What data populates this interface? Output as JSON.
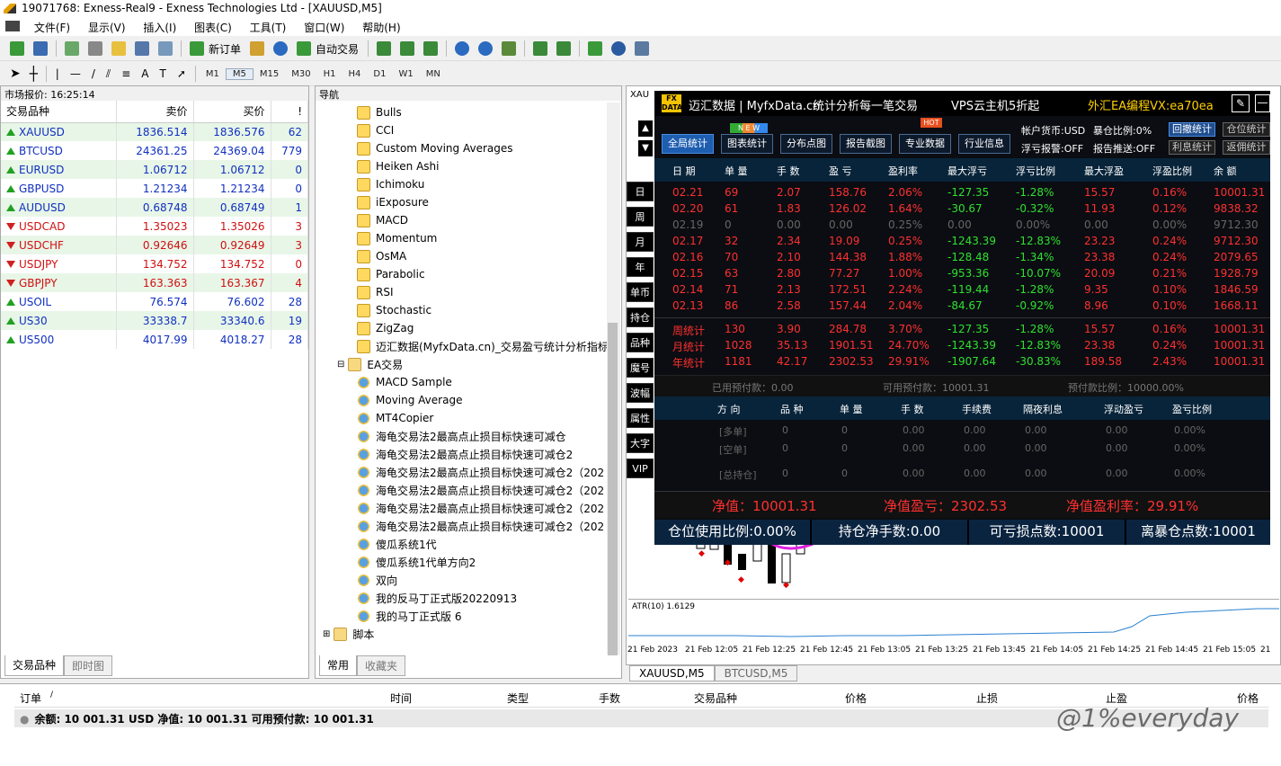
{
  "window": {
    "title": "19071768: Exness-Real9 - Exness Technologies Ltd - [XAUUSD,M5]"
  },
  "menu": [
    "文件(F)",
    "显示(V)",
    "插入(I)",
    "图表(C)",
    "工具(T)",
    "窗口(W)",
    "帮助(H)"
  ],
  "toolbar": {
    "new_order": "新订单",
    "auto_trade": "自动交易",
    "timeframes": [
      "M1",
      "M5",
      "M15",
      "M30",
      "H1",
      "H4",
      "D1",
      "W1",
      "MN"
    ],
    "active_tf": "M5"
  },
  "market_watch": {
    "title": "市场报价: 16:25:14",
    "cols": [
      "交易品种",
      "卖价",
      "买价",
      "!"
    ],
    "rows": [
      {
        "sym": "XAUUSD",
        "bid": "1836.514",
        "ask": "1836.576",
        "spread": "62",
        "dir": "up"
      },
      {
        "sym": "BTCUSD",
        "bid": "24361.25",
        "ask": "24369.04",
        "spread": "779",
        "dir": "up"
      },
      {
        "sym": "EURUSD",
        "bid": "1.06712",
        "ask": "1.06712",
        "spread": "0",
        "dir": "up"
      },
      {
        "sym": "GBPUSD",
        "bid": "1.21234",
        "ask": "1.21234",
        "spread": "0",
        "dir": "up"
      },
      {
        "sym": "AUDUSD",
        "bid": "0.68748",
        "ask": "0.68749",
        "spread": "1",
        "dir": "up"
      },
      {
        "sym": "USDCAD",
        "bid": "1.35023",
        "ask": "1.35026",
        "spread": "3",
        "dir": "dn"
      },
      {
        "sym": "USDCHF",
        "bid": "0.92646",
        "ask": "0.92649",
        "spread": "3",
        "dir": "dn"
      },
      {
        "sym": "USDJPY",
        "bid": "134.752",
        "ask": "134.752",
        "spread": "0",
        "dir": "dn"
      },
      {
        "sym": "GBPJPY",
        "bid": "163.363",
        "ask": "163.367",
        "spread": "4",
        "dir": "dn"
      },
      {
        "sym": "USOIL",
        "bid": "76.574",
        "ask": "76.602",
        "spread": "28",
        "dir": "up"
      },
      {
        "sym": "US30",
        "bid": "33338.7",
        "ask": "33340.6",
        "spread": "19",
        "dir": "up"
      },
      {
        "sym": "US500",
        "bid": "4017.99",
        "ask": "4018.27",
        "spread": "28",
        "dir": "up"
      }
    ],
    "tabs": [
      "交易品种",
      "即时图"
    ]
  },
  "navigator": {
    "title": "导航",
    "indicators": [
      "Bulls",
      "CCI",
      "Custom Moving Averages",
      "Heiken Ashi",
      "Ichimoku",
      "iExposure",
      "MACD",
      "Momentum",
      "OsMA",
      "Parabolic",
      "RSI",
      "Stochastic",
      "ZigZag",
      "迈汇数据(MyfxData.cn)_交易盈亏统计分析指标"
    ],
    "ea_folder": "EA交易",
    "eas": [
      "MACD Sample",
      "Moving Average",
      "MT4Copier",
      "海龟交易法2最高点止损目标快速可减仓",
      "海龟交易法2最高点止损目标快速可减仓2",
      "海龟交易法2最高点止损目标快速可减仓2（202",
      "海龟交易法2最高点止损目标快速可减仓2（202",
      "海龟交易法2最高点止损目标快速可减仓2（202",
      "海龟交易法2最高点止损目标快速可减仓2（202",
      "傻瓜系统1代",
      "傻瓜系统1代单方向2",
      "双向",
      "我的反马丁正式版20220913",
      "我的马丁正式版 6"
    ],
    "scripts": "脚本",
    "tabs": [
      "常用",
      "收藏夹"
    ]
  },
  "ea_panel": {
    "logo": "FX DATA",
    "brand": "迈汇数据 | MyfxData.cn",
    "slogan": "统计分析每一笔交易",
    "vps": "VPS云主机5折起",
    "promo": "外汇EA编程VX:ea70ea",
    "buttons": [
      "全局统计",
      "图表统计",
      "分布点图",
      "报告截图",
      "专业数据",
      "行业信息"
    ],
    "new_badge": "N E W",
    "hot_badge": "HOT",
    "status": [
      "帐户货币:USD",
      "暴仓比例:0%",
      "浮亏报警:OFF",
      "报告推送:OFF"
    ],
    "right_buttons": [
      "回撤统计",
      "仓位统计",
      "利息统计",
      "返佣统计"
    ],
    "side": [
      "日",
      "周",
      "月",
      "年",
      "单币",
      "持仓",
      "品种",
      "魔号",
      "波幅",
      "属性",
      "大字",
      "VIP"
    ],
    "cols": [
      "日 期",
      "单 量",
      "手 数",
      "盈 亏",
      "盈利率",
      "最大浮亏",
      "浮亏比例",
      "最大浮盈",
      "浮盈比例",
      "余 额"
    ],
    "rows": [
      [
        "02.21",
        "69",
        "2.07",
        "158.76",
        "2.06%",
        "-127.35",
        "-1.28%",
        "15.57",
        "0.16%",
        "10001.31"
      ],
      [
        "02.20",
        "61",
        "1.83",
        "126.02",
        "1.64%",
        "-30.67",
        "-0.32%",
        "11.93",
        "0.12%",
        "9838.32"
      ],
      [
        "02.19",
        "0",
        "0.00",
        "0.00",
        "0.25%",
        "0.00",
        "0.00%",
        "0.00",
        "0.00%",
        "9712.30"
      ],
      [
        "02.17",
        "32",
        "2.34",
        "19.09",
        "0.25%",
        "-1243.39",
        "-12.83%",
        "23.23",
        "0.24%",
        "9712.30"
      ],
      [
        "02.16",
        "70",
        "2.10",
        "144.38",
        "1.88%",
        "-128.48",
        "-1.34%",
        "23.38",
        "0.24%",
        "2079.65"
      ],
      [
        "02.15",
        "63",
        "2.80",
        "77.27",
        "1.00%",
        "-953.36",
        "-10.07%",
        "20.09",
        "0.21%",
        "1928.79"
      ],
      [
        "02.14",
        "71",
        "2.13",
        "172.51",
        "2.24%",
        "-119.44",
        "-1.28%",
        "9.35",
        "0.10%",
        "1846.59"
      ],
      [
        "02.13",
        "86",
        "2.58",
        "157.44",
        "2.04%",
        "-84.67",
        "-0.92%",
        "8.96",
        "0.10%",
        "1668.11"
      ]
    ],
    "summary": [
      [
        "周统计",
        "130",
        "3.90",
        "284.78",
        "3.70%",
        "-127.35",
        "-1.28%",
        "15.57",
        "0.16%",
        "10001.31"
      ],
      [
        "月统计",
        "1028",
        "35.13",
        "1901.51",
        "24.70%",
        "-1243.39",
        "-12.83%",
        "23.38",
        "0.24%",
        "10001.31"
      ],
      [
        "年统计",
        "1181",
        "42.17",
        "2302.53",
        "29.91%",
        "-1907.64",
        "-30.83%",
        "189.58",
        "2.43%",
        "10001.31"
      ]
    ],
    "margin_line": [
      "已用预付款：0.00",
      "可用预付款：10001.31",
      "预付款比例：10000.00%"
    ],
    "pos_cols": [
      "方 向",
      "品 种",
      "单 量",
      "手 数",
      "手续费",
      "隔夜利息",
      "浮动盈亏",
      "盈亏比例"
    ],
    "pos_rows": [
      [
        "[多单]",
        "0",
        "0",
        "0.00",
        "0.00",
        "0.00",
        "0.00",
        "0.00%"
      ],
      [
        "[空单]",
        "0",
        "0",
        "0.00",
        "0.00",
        "0.00",
        "0.00",
        "0.00%"
      ],
      [
        "[总持仓]",
        "0",
        "0",
        "0.00",
        "0.00",
        "0.00",
        "0.00",
        "0.00%"
      ]
    ],
    "equity": "净值：10001.31",
    "equity_pl": "净值盈亏：2302.53",
    "equity_rate": "净值盈利率：29.91%",
    "bottom": [
      "仓位使用比例:0.00%",
      "持仓净手数:0.00",
      "可亏损点数:10001",
      "离暴仓点数:10001"
    ]
  },
  "chart": {
    "tab_label": "XAU",
    "atr_label": "ATR(10) 1.6129",
    "xaxis": [
      "21 Feb 2023",
      "21 Feb 12:05",
      "21 Feb 12:25",
      "21 Feb 12:45",
      "21 Feb 13:05",
      "21 Feb 13:25",
      "21 Feb 13:45",
      "21 Feb 14:05",
      "21 Feb 14:25",
      "21 Feb 14:45",
      "21 Feb 15:05",
      "21"
    ],
    "tabs": [
      "XAUUSD,M5",
      "BTCUSD,M5"
    ]
  },
  "terminal": {
    "cols": [
      "订单",
      "/",
      "时间",
      "类型",
      "手数",
      "交易品种",
      "价格",
      "止损",
      "止盈",
      "价格"
    ],
    "balance": "余额: 10 001.31 USD  净值: 10 001.31  可用预付款: 10 001.31"
  },
  "watermark": "@1%everyday",
  "colors": {
    "up": "#22a022",
    "down": "#d02020",
    "blue": "#1030c0",
    "ea_bg": "#0b0d12",
    "ea_green": "#30e030",
    "ea_red": "#ff3030",
    "ea_yellow": "#ffd000"
  }
}
